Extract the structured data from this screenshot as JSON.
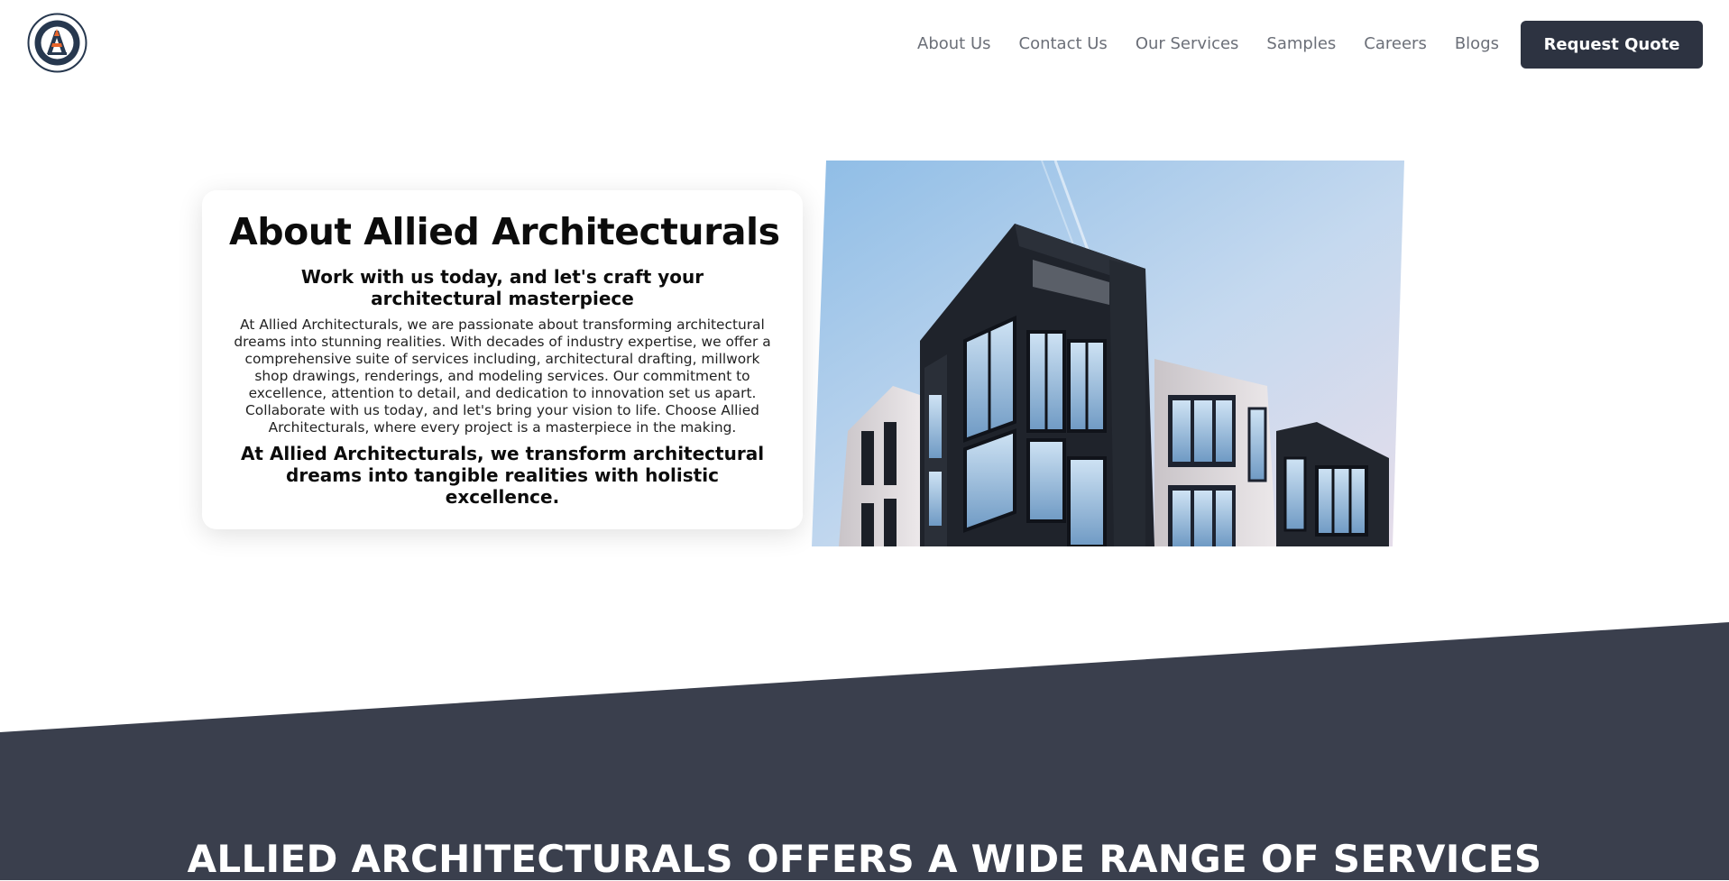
{
  "brand": {
    "logo_icon": "allied-architecturals-logo",
    "logo_text_top": "ALLIED",
    "logo_text_bottom": "ARCHITECTURALS"
  },
  "nav": {
    "items": [
      {
        "label": "About Us"
      },
      {
        "label": "Contact Us"
      },
      {
        "label": "Our Services"
      },
      {
        "label": "Samples"
      },
      {
        "label": "Careers"
      },
      {
        "label": "Blogs"
      }
    ],
    "cta_label": "Request Quote"
  },
  "about": {
    "title": "About Allied Architecturals",
    "subtitle": "Work with us today, and let's craft your architectural masterpiece",
    "body": "At Allied Architecturals, we are passionate about transforming architectural dreams into stunning realities. With decades of industry expertise, we offer a comprehensive suite of services including, architectural drafting, millwork shop drawings, renderings, and modeling services. Our commitment to excellence, attention to detail, and dedication to innovation set us apart. Collaborate with us today, and let's bring your vision to life. Choose Allied Architecturals, where every project is a masterpiece in the making.",
    "tagline": "At Allied Architecturals, we transform architectural dreams into tangible realities with holistic excellence."
  },
  "hero_image": {
    "icon": "modern-building-photo"
  },
  "services": {
    "heading": "ALLIED ARCHITECTURALS OFFERS A WIDE RANGE OF SERVICES"
  },
  "colors": {
    "primary_dark": "#2d3341",
    "section_dark": "#3a3f4d",
    "nav_text": "#6b6f78",
    "logo_orange": "#e8642a",
    "logo_navy": "#27384f"
  }
}
